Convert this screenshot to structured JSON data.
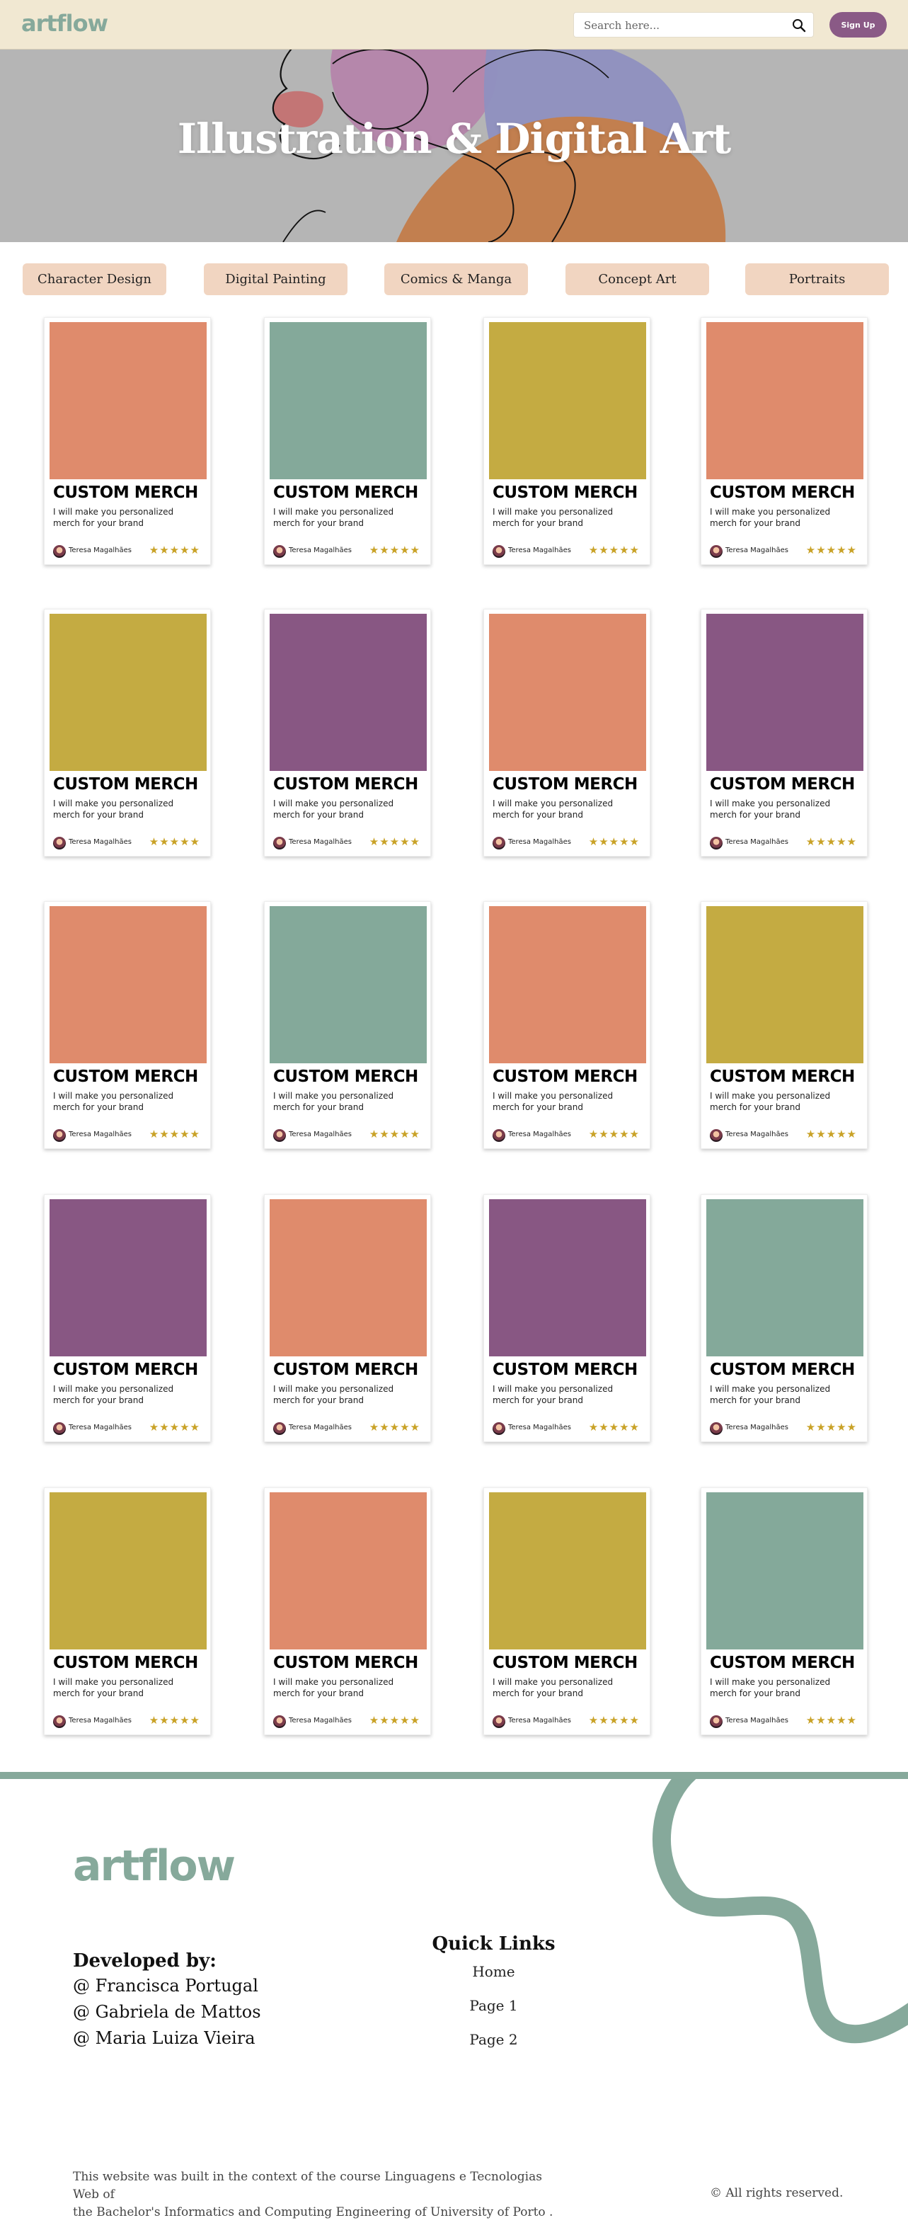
{
  "header": {
    "logo": "artflow",
    "search_placeholder": "Search here...",
    "signup_label": "Sign Up"
  },
  "hero": {
    "title": "Illustration & Digital Art"
  },
  "categories": [
    "Character Design",
    "Digital Painting",
    "Comics & Manga",
    "Concept Art",
    "Portraits"
  ],
  "colors": {
    "header_bg": "#f1e8d2",
    "accent_green": "#86a99b",
    "signup_purple": "#8a5a86",
    "category_bg": "#f1d5c1",
    "star": "#c9a227",
    "orange": "#df8b6c",
    "green": "#84a99a",
    "mustard": "#c4ab42",
    "purple": "#885783"
  },
  "card_defaults": {
    "title": "CUSTOM MERCH",
    "description": "I will make you personalized merch for your brand",
    "author": "Teresa Magalhães",
    "rating_stars": 5
  },
  "cards": [
    {
      "color": "orange"
    },
    {
      "color": "green"
    },
    {
      "color": "mustard"
    },
    {
      "color": "orange"
    },
    {
      "color": "mustard"
    },
    {
      "color": "purple"
    },
    {
      "color": "orange"
    },
    {
      "color": "purple"
    },
    {
      "color": "orange"
    },
    {
      "color": "green"
    },
    {
      "color": "orange"
    },
    {
      "color": "mustard"
    },
    {
      "color": "purple"
    },
    {
      "color": "orange"
    },
    {
      "color": "purple"
    },
    {
      "color": "green"
    },
    {
      "color": "mustard"
    },
    {
      "color": "orange"
    },
    {
      "color": "mustard"
    },
    {
      "color": "green"
    }
  ],
  "footer": {
    "logo": "artflow",
    "developed_by_title": "Developed by:",
    "developers": [
      "@ Francisca Portugal",
      "@ Gabriela de Mattos",
      "@ Maria Luiza Vieira"
    ],
    "quick_links_title": "Quick Links",
    "quick_links": [
      "Home",
      "Page 1",
      "Page 2"
    ],
    "note_line1": "This website was built in the context of the course Linguagens  e Tecnologias Web of",
    "note_line2": "the Bachelor's Informatics and Computing Engineering of University of Porto .",
    "rights": "© All rights reserved."
  }
}
